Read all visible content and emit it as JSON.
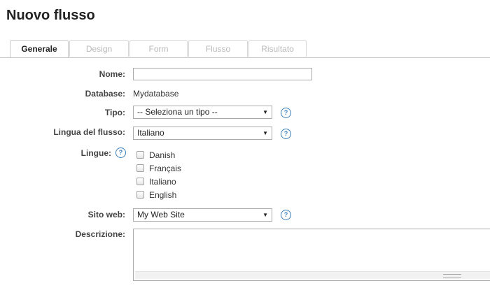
{
  "page": {
    "title": "Nuovo flusso"
  },
  "tabs": [
    {
      "label": "Generale",
      "active": true
    },
    {
      "label": "Design",
      "active": false
    },
    {
      "label": "Form",
      "active": false
    },
    {
      "label": "Flusso",
      "active": false
    },
    {
      "label": "Risultato",
      "active": false
    }
  ],
  "form": {
    "nome": {
      "label": "Nome:",
      "value": ""
    },
    "database": {
      "label": "Database:",
      "value": "Mydatabase"
    },
    "tipo": {
      "label": "Tipo:",
      "selected": "-- Seleziona un tipo --"
    },
    "lingua_flusso": {
      "label": "Lingua del flusso:",
      "selected": "Italiano"
    },
    "lingue": {
      "label": "Lingue:",
      "options": [
        {
          "label": "Danish",
          "checked": false
        },
        {
          "label": "Français",
          "checked": false
        },
        {
          "label": "Italiano",
          "checked": false
        },
        {
          "label": "English",
          "checked": false
        }
      ]
    },
    "sito_web": {
      "label": "Sito web:",
      "selected": "My Web Site"
    },
    "descrizione": {
      "label": "Descrizione:",
      "value": ""
    }
  },
  "icons": {
    "help": "help-question-icon",
    "dropdown": "dropdown-arrow-icon"
  },
  "help_glyph": "?",
  "arrow_glyph": "▼",
  "colors": {
    "help_accent": "#3a7fb8",
    "tab_inactive_text": "#b9b9b9"
  }
}
